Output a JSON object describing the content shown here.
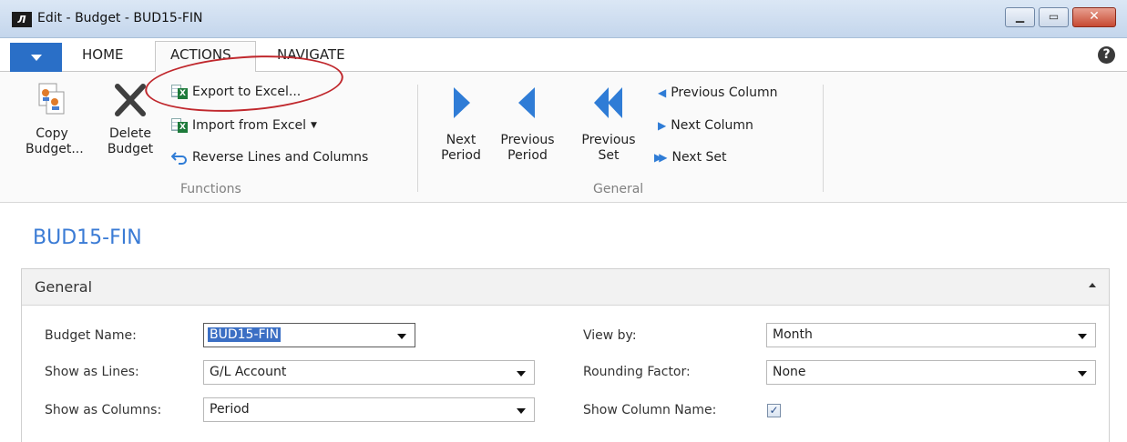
{
  "window": {
    "title": "Edit - Budget - BUD15-FIN",
    "logo": "logo-icon"
  },
  "tabs": {
    "home": "HOME",
    "actions": "ACTIONS",
    "navigate": "NAVIGATE"
  },
  "ribbon": {
    "copy_budget": [
      "Copy",
      "Budget..."
    ],
    "delete_budget": [
      "Delete",
      "Budget"
    ],
    "export_to_excel": "Export to Excel...",
    "import_from_excel": "Import from Excel",
    "reverse_lines_columns": "Reverse Lines and Columns",
    "functions_label": "Functions",
    "next_period": [
      "Next",
      "Period"
    ],
    "previous_period": [
      "Previous",
      "Period"
    ],
    "previous_set": [
      "Previous",
      "Set"
    ],
    "previous_column": "Previous Column",
    "next_column": "Next Column",
    "next_set": "Next Set",
    "general_label": "General"
  },
  "page": {
    "title": "BUD15-FIN"
  },
  "general": {
    "heading": "General",
    "budget_name_label": "Budget Name:",
    "budget_name_value": "BUD15-FIN",
    "show_as_lines_label": "Show as Lines:",
    "show_as_lines_value": "G/L Account",
    "show_as_columns_label": "Show as Columns:",
    "show_as_columns_value": "Period",
    "view_by_label": "View by:",
    "view_by_value": "Month",
    "rounding_factor_label": "Rounding Factor:",
    "rounding_factor_value": "None",
    "show_column_name_label": "Show Column Name:",
    "show_column_name_checked": true
  },
  "colors": {
    "accent": "#3a7bd5",
    "nav_arrow": "#2f7cd6",
    "annotation": "#c0282d"
  }
}
